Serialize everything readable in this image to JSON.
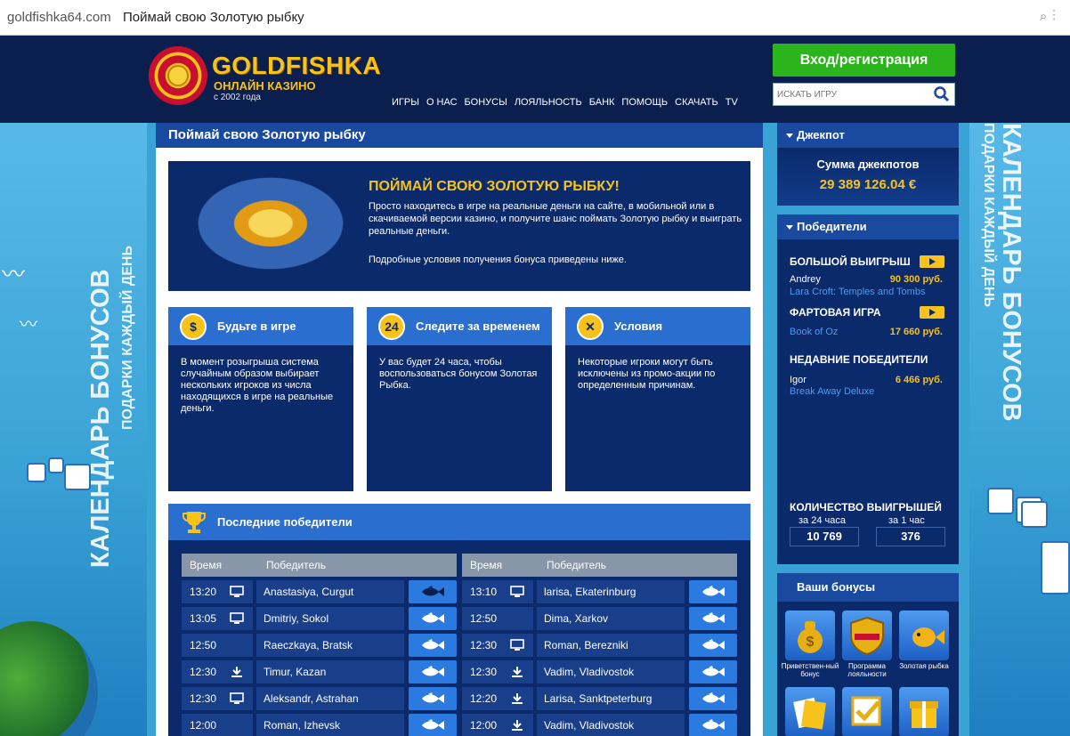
{
  "browser": {
    "url": "goldfishka64.com",
    "title": "Поймай свою Золотую рыбку"
  },
  "header": {
    "brand": "GOLDFISHKA",
    "brand_sub": "ОНЛАЙН КАЗИНО",
    "since": "с 2002 года",
    "nav": [
      "ИГРЫ",
      "О НАС",
      "БОНУСЫ",
      "ЛОЯЛЬНОСТЬ",
      "БАНК",
      "ПОМОЩЬ",
      "СКАЧАТЬ",
      "TV"
    ],
    "login_label": "Вход/регистрация",
    "search_placeholder": "ИСКАТЬ ИГРУ"
  },
  "side": {
    "banner_big": "КАЛЕНДАРЬ БОНУСОВ",
    "banner_small": "ПОДАРКИ КАЖДЫЙ ДЕНЬ"
  },
  "main": {
    "title": "Поймай свою Золотую рыбку",
    "hero": {
      "heading": "ПОЙМАЙ СВОЮ ЗОЛОТУЮ РЫБКУ!",
      "p1": "Просто находитесь в игре на реальные деньги на сайте, в мобильной или в скачиваемой версии казино, и получите шанс поймать Золотую рыбку и выиграть реальные деньги.",
      "p2": "Подробные условия получения бонуса приведены ниже."
    },
    "cards": [
      {
        "title": "Будьте в игре",
        "text": "В момент розыгрыша система случайным образом выбирает нескольких игроков из числа находящихся в игре на реальные деньги."
      },
      {
        "title": "Следите за временем",
        "text": "У вас будет 24 часа, чтобы воспользоваться бонусом Золотая Рыбка.",
        "badge": "24"
      },
      {
        "title": "Условия",
        "text": "Некоторые игроки могут быть исключены из промо-акции по определенным причинам."
      }
    ],
    "winners": {
      "title": "Последние победители",
      "col_time": "Время",
      "col_winner": "Победитель",
      "left": [
        {
          "time": "13:20",
          "device": "monitor-icon",
          "name": "Anastasiya, Curgut",
          "fish": "dark"
        },
        {
          "time": "13:05",
          "device": "monitor-icon",
          "name": "Dmitriy, Sokol",
          "fish": "white"
        },
        {
          "time": "12:50",
          "device": "",
          "name": "Raeczkaya, Bratsk",
          "fish": "white"
        },
        {
          "time": "12:30",
          "device": "download-icon",
          "name": "Timur, Kazan",
          "fish": "white"
        },
        {
          "time": "12:30",
          "device": "monitor-icon",
          "name": "Aleksandr, Astrahan",
          "fish": "white"
        },
        {
          "time": "12:00",
          "device": "",
          "name": "Roman, Izhevsk",
          "fish": "white"
        }
      ],
      "right": [
        {
          "time": "13:10",
          "device": "monitor-icon",
          "name": "larisa, Ekaterinburg",
          "fish": "white"
        },
        {
          "time": "12:50",
          "device": "",
          "name": "Dima, Xarkov",
          "fish": "white"
        },
        {
          "time": "12:30",
          "device": "monitor-icon",
          "name": "Roman, Berezniki",
          "fish": "white"
        },
        {
          "time": "12:30",
          "device": "download-icon",
          "name": "Vadim, Vladivostok",
          "fish": "white"
        },
        {
          "time": "12:20",
          "device": "download-icon",
          "name": "Larisa, Sanktpeterburg",
          "fish": "white"
        },
        {
          "time": "12:00",
          "device": "download-icon",
          "name": "Vadim, Vladivostok",
          "fish": "white"
        }
      ]
    }
  },
  "sidebar": {
    "jackpot": {
      "title": "Джекпот",
      "label": "Сумма джекпотов",
      "amount": "29 389 126.04 €"
    },
    "winners": {
      "title": "Победители",
      "big_win": "БОЛЬШОЙ ВЫИГРЫШ",
      "big_name": "Andrey",
      "big_amount": "90 300 руб.",
      "big_game": "Lara Croft: Temples and Tombs",
      "lucky": "ФАРТОВАЯ ИГРА",
      "lucky_game": "Book of Oz",
      "lucky_amount": "17 660 руб.",
      "recent": "НЕДАВНИЕ ПОБЕДИТЕЛИ",
      "recent_name": "Igor",
      "recent_amount": "6 466 руб.",
      "recent_game": "Break Away Deluxe",
      "count_title": "КОЛИЧЕСТВО ВЫИГРЫШЕЙ",
      "count_24h_label": "за 24 часа",
      "count_24h": "10 769",
      "count_1h_label": "за 1 час",
      "count_1h": "376"
    },
    "bonuses": {
      "title": "Ваши бонусы",
      "items": [
        "Приветствен-ный бонус",
        "Программа лояльности",
        "Золотая рыбка"
      ]
    }
  }
}
